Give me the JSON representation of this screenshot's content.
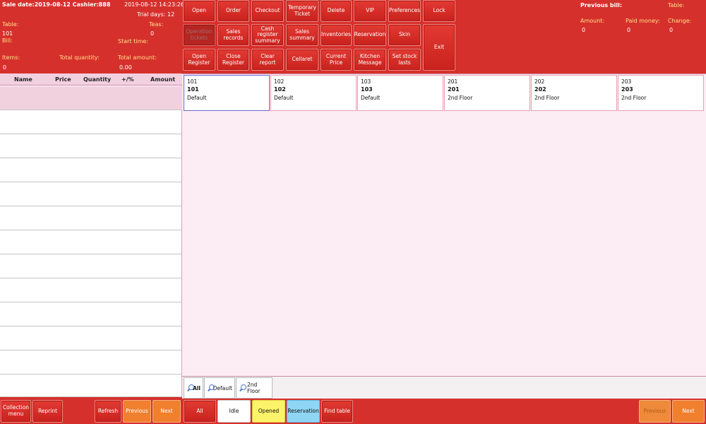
{
  "header": {
    "sale_line": "Sale date:2019-08-12 Cashier:888",
    "datetime": "2019-08-12 14:23:26",
    "trial": "Trial days: 12",
    "table_label": "Table:",
    "table_value": "101",
    "teas_label": "Teas:",
    "teas_value": "0",
    "bill_label": "Bill:",
    "start_label": "Start time:",
    "items_label": "Items:",
    "items_value": "0",
    "qty_label": "Total quantity:",
    "amount_label": "Total amount:",
    "amount_value": "0.00"
  },
  "previous_bill": {
    "title": "Previous bill:",
    "table_label": "Table:",
    "amount_label": "Amount:",
    "amount_value": "0",
    "paid_label": "Paid money:",
    "paid_value": "0",
    "change_label": "Change:",
    "change_value": "0"
  },
  "toolbar": {
    "open": "Open",
    "order": "Order",
    "checkout": "Checkout",
    "temp_ticket": "Temporary Ticket",
    "delete": "Delete",
    "vip": "VIP",
    "preferences": "Preferences",
    "lock": "Lock",
    "exit": "Exit",
    "disabled1": "Operation tickets",
    "sales_records": "Sales records",
    "cash_register_summary": "Cash register summary",
    "sales_summary": "Sales summary",
    "inventories": "Inventories",
    "reservation": "Reservation",
    "skin": "Skin",
    "open_register": "Open Register",
    "close_register": "Close Register",
    "clear_report": "Clear report",
    "cellaret": "Cellaret",
    "current_price": "Current Price",
    "kitchen_message": "Kitchen Message",
    "set_stock_lasts": "Set stock lasts"
  },
  "order_table": {
    "columns": [
      "Name",
      "Price",
      "Quantity",
      "+/%",
      "Amount"
    ]
  },
  "tables": [
    {
      "code": "101",
      "name": "101",
      "area": "Default"
    },
    {
      "code": "102",
      "name": "102",
      "area": "Default"
    },
    {
      "code": "103",
      "name": "103",
      "area": "Default"
    },
    {
      "code": "201",
      "name": "201",
      "area": "2nd Floor"
    },
    {
      "code": "202",
      "name": "202",
      "area": "2nd Floor"
    },
    {
      "code": "203",
      "name": "203",
      "area": "2nd Floor"
    }
  ],
  "area_filters": {
    "all": "All",
    "default": "Default",
    "second_floor": "2nd Floor"
  },
  "bottom": {
    "collection_menu": "Collection menu",
    "reprint": "Reprint",
    "refresh": "Refresh",
    "previous": "Previous",
    "next": "Next",
    "status_all": "All",
    "status_idle": "Idle",
    "status_opened": "Opened",
    "status_reservation": "Reservation",
    "find_table": "Find table",
    "page_previous": "Previous",
    "page_next": "Next"
  },
  "colors": {
    "background": "#d6302c",
    "accent_yellow": "#ffe08a",
    "orange": "#f07f2e",
    "opened": "#fdf36a",
    "reservation": "#8ed6f4"
  }
}
